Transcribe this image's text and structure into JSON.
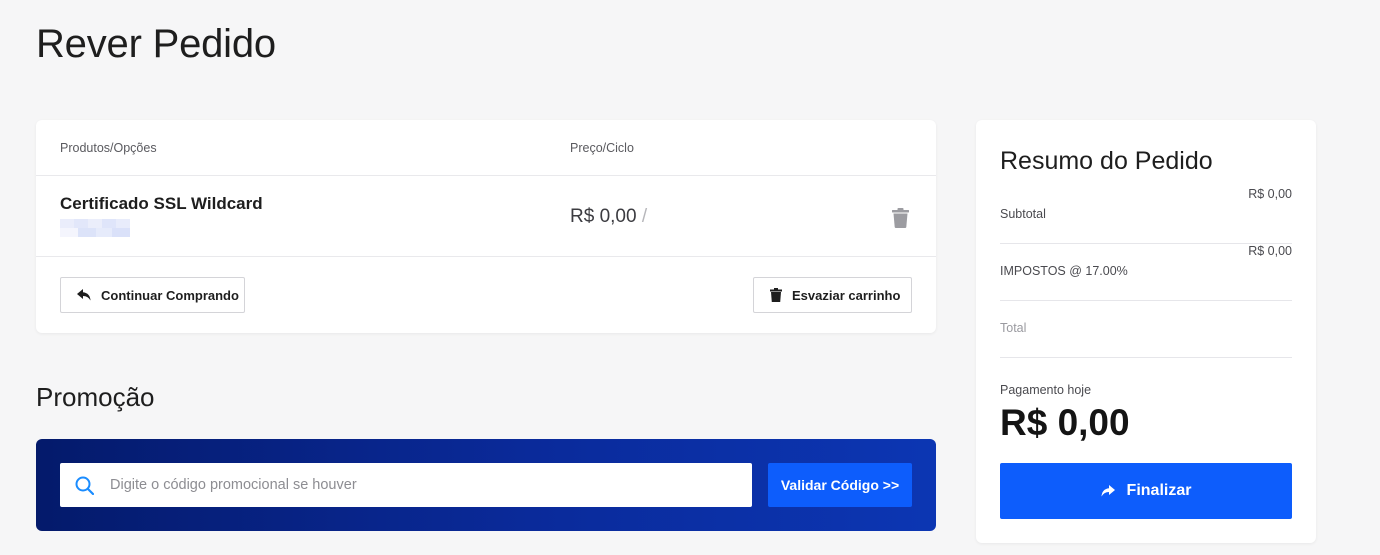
{
  "page": {
    "title": "Rever Pedido"
  },
  "cart": {
    "headers": {
      "products": "Produtos/Opções",
      "price": "Preço/Ciclo"
    },
    "items": [
      {
        "name": "Certificado SSL Wildcard",
        "price": "R$ 0,00",
        "cycle_separator": "/"
      }
    ],
    "continue_label": "Continuar Comprando",
    "empty_label": "Esvaziar carrinho"
  },
  "promo": {
    "title": "Promoção",
    "placeholder": "Digite o código promocional se houver",
    "validate_label": "Validar Código >>"
  },
  "summary": {
    "title": "Resumo do Pedido",
    "subtotal_label": "Subtotal",
    "subtotal_value": "R$ 0,00",
    "tax_label": "IMPOSTOS @ 17.00%",
    "tax_value": "R$ 0,00",
    "total_label": "Total",
    "pay_today_label": "Pagamento hoje",
    "pay_today_value": "R$ 0,00",
    "finalize_label": "Finalizar"
  },
  "icons": {
    "trash": "trash-icon",
    "reply": "reply-arrow-icon",
    "search": "search-icon",
    "share": "share-arrow-icon"
  },
  "colors": {
    "accent": "#0d5dfc",
    "promo_bg_start": "#041a6b",
    "promo_bg_end": "#0c36b3"
  }
}
